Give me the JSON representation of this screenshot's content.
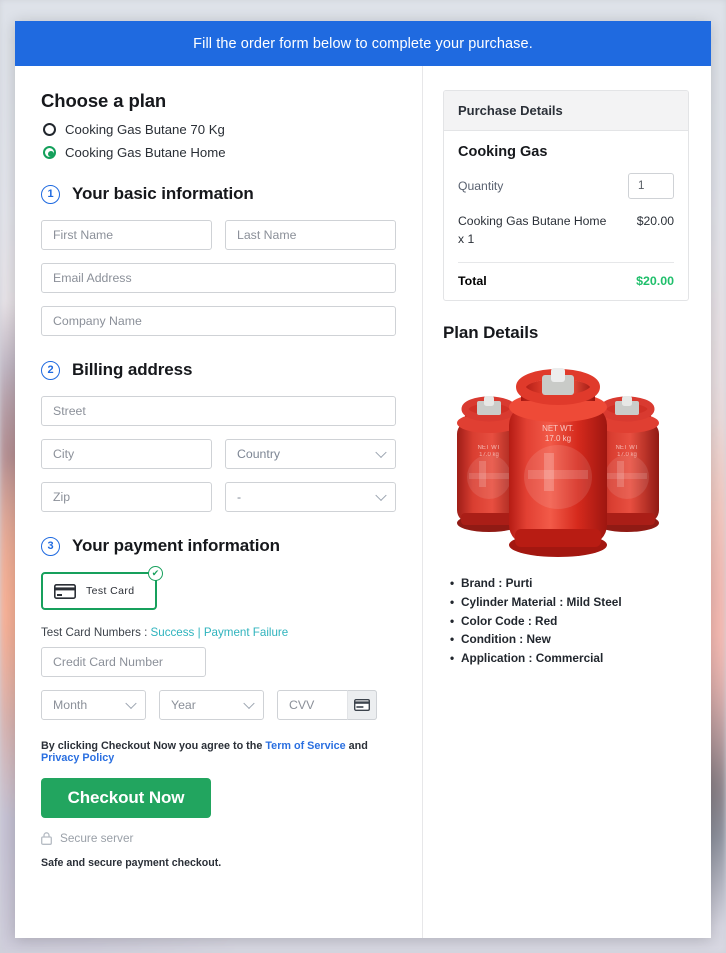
{
  "banner": {
    "text": "Fill the order form below to complete your purchase."
  },
  "plan": {
    "heading": "Choose a plan",
    "options": [
      {
        "label": "Cooking Gas Butane 70 Kg",
        "selected": false
      },
      {
        "label": "Cooking Gas Butane Home",
        "selected": true
      }
    ]
  },
  "steps": {
    "basic": {
      "number": "1",
      "label": "Your basic information"
    },
    "billing": {
      "number": "2",
      "label": "Billing address"
    },
    "payment": {
      "number": "3",
      "label": "Your payment information"
    }
  },
  "basic_fields": {
    "first_name": "First Name",
    "last_name": "Last Name",
    "email": "Email Address",
    "company": "Company Name"
  },
  "billing_fields": {
    "street": "Street",
    "city": "City",
    "country": "Country",
    "zip": "Zip",
    "state": "-"
  },
  "payment": {
    "method_label": "Test  Card",
    "method_icon": "credit-card-icon",
    "method_check_icon": "check-circle-icon",
    "test_cards_prefix": "Test Card Numbers : ",
    "test_card_success": "Success",
    "test_card_separator": " | ",
    "test_card_failure": "Payment Failure",
    "card_number": "Credit Card Number",
    "month": "Month",
    "year": "Year",
    "cvv": "CVV",
    "cvv_icon": "credit-card-back-icon"
  },
  "terms": {
    "prefix": "By clicking Checkout Now you agree to the ",
    "link1": "Term of Service",
    "middle": " and ",
    "link2": "Privacy Policy"
  },
  "checkout": {
    "button_label": "Checkout Now",
    "secure_icon": "lock-icon",
    "secure_label": "Secure server",
    "safe_note": "Safe and secure payment checkout."
  },
  "purchase": {
    "header": "Purchase Details",
    "product": "Cooking Gas",
    "quantity_label": "Quantity",
    "quantity_value": "1",
    "line_item_desc": "Cooking Gas Butane Home x 1",
    "line_item_price": "$20.00",
    "total_label": "Total",
    "total_value": "$20.00"
  },
  "plan_details": {
    "heading": "Plan Details",
    "image_alt": "gas-cylinders-image",
    "bullets": [
      "Brand : Purti",
      "Cylinder Material : Mild Steel",
      "Color Code : Red",
      "Condition : New",
      "Application : Commercial"
    ]
  },
  "colors": {
    "banner": "#1f6ae0",
    "accent_blue": "#2a6fe0",
    "green": "#22a55f",
    "total_green": "#1fbf6b",
    "teal_link": "#2fb3bd",
    "cylinder_red": "#d22a1e"
  }
}
